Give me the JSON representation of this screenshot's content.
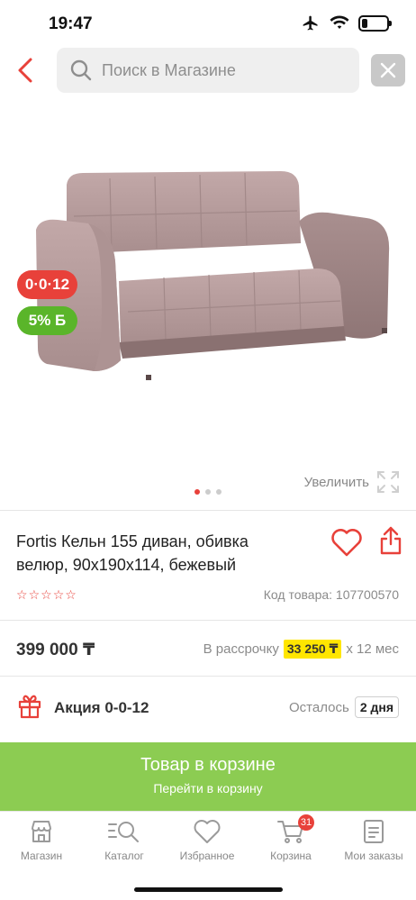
{
  "status_bar": {
    "time": "19:47"
  },
  "search": {
    "placeholder": "Поиск в Магазине"
  },
  "product": {
    "title": "Fortis Кельн 155 диван, обивка велюр, 90х190х114, бежевый",
    "zoom_label": "Увеличить",
    "badges": {
      "installment": "0·0·12",
      "bonus": "5% Б"
    },
    "rating_stars": 0,
    "sku": "Код товара: 107700570",
    "price": "399 000 ₸",
    "installment": {
      "prefix": "В рассрочку",
      "amount": "33 250 ₸",
      "suffix": "х 12 мес"
    },
    "image_count": 3,
    "active_image": 1
  },
  "promo": {
    "label": "Акция 0-0-12",
    "remaining_label": "Осталось",
    "remaining_value": "2 дня"
  },
  "cart_button": {
    "title": "Товар в корзине",
    "subtitle": "Перейти в корзину"
  },
  "tabs": [
    {
      "label": "Магазин",
      "icon": "shop-icon"
    },
    {
      "label": "Каталог",
      "icon": "catalog-search-icon"
    },
    {
      "label": "Избранное",
      "icon": "heart-icon"
    },
    {
      "label": "Корзина",
      "icon": "cart-icon",
      "badge": "31"
    },
    {
      "label": "Мои заказы",
      "icon": "orders-icon"
    }
  ],
  "colors": {
    "accent_red": "#e8413a",
    "green": "#8ccc52",
    "badge_green": "#5ab52a",
    "highlight_yellow": "#ffe600"
  }
}
